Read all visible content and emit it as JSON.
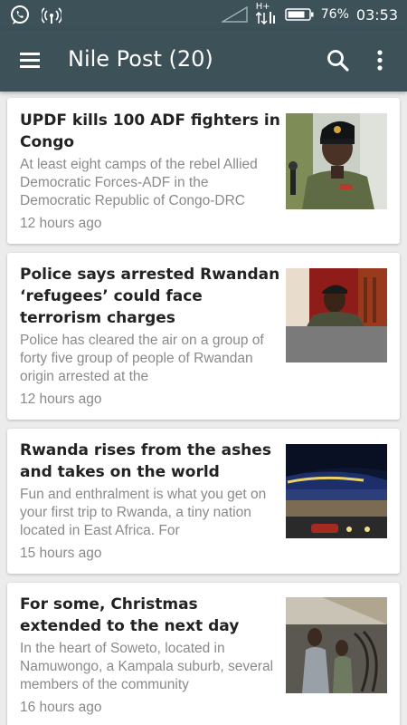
{
  "status_bar": {
    "battery_percent": "76%",
    "time": "03:53",
    "network_label": "H+",
    "icons": [
      "whatsapp-icon",
      "hotspot-icon",
      "signal-icon",
      "data-arrows-icon",
      "battery-icon"
    ]
  },
  "app_bar": {
    "title": "Nile Post (20)",
    "icons": [
      "menu-icon",
      "search-icon",
      "more-vert-icon"
    ]
  },
  "articles": [
    {
      "headline": "UPDF kills 100 ADF fighters in Congo",
      "summary": "At least eight camps of the rebel Allied Democratic Forces-ADF in the Democratic Republic of Congo-DRC",
      "time": "12 hours ago"
    },
    {
      "headline": "Police says arrested Rwandan ‘refugees’ could  face terrorism charges",
      "summary": "Police has cleared the air on a group of forty five  group of people of Rwandan origin arrested at the",
      "time": "12 hours ago"
    },
    {
      "headline": "Rwanda rises from the ashes and takes on the world",
      "summary": "Fun and enthralment is what you get on your first trip to Rwanda, a tiny nation located in East Africa. For",
      "time": "15 hours ago"
    },
    {
      "headline": "For some, Christmas extended to the next day",
      "summary": "In the heart of Soweto, located in Namuwongo, a Kampala suburb, several members of the community",
      "time": "16 hours ago"
    }
  ],
  "colors": {
    "bar": "#3c5158",
    "background": "#ececec",
    "card": "#ffffff",
    "headline": "#222222",
    "meta": "#8a8a8a"
  }
}
